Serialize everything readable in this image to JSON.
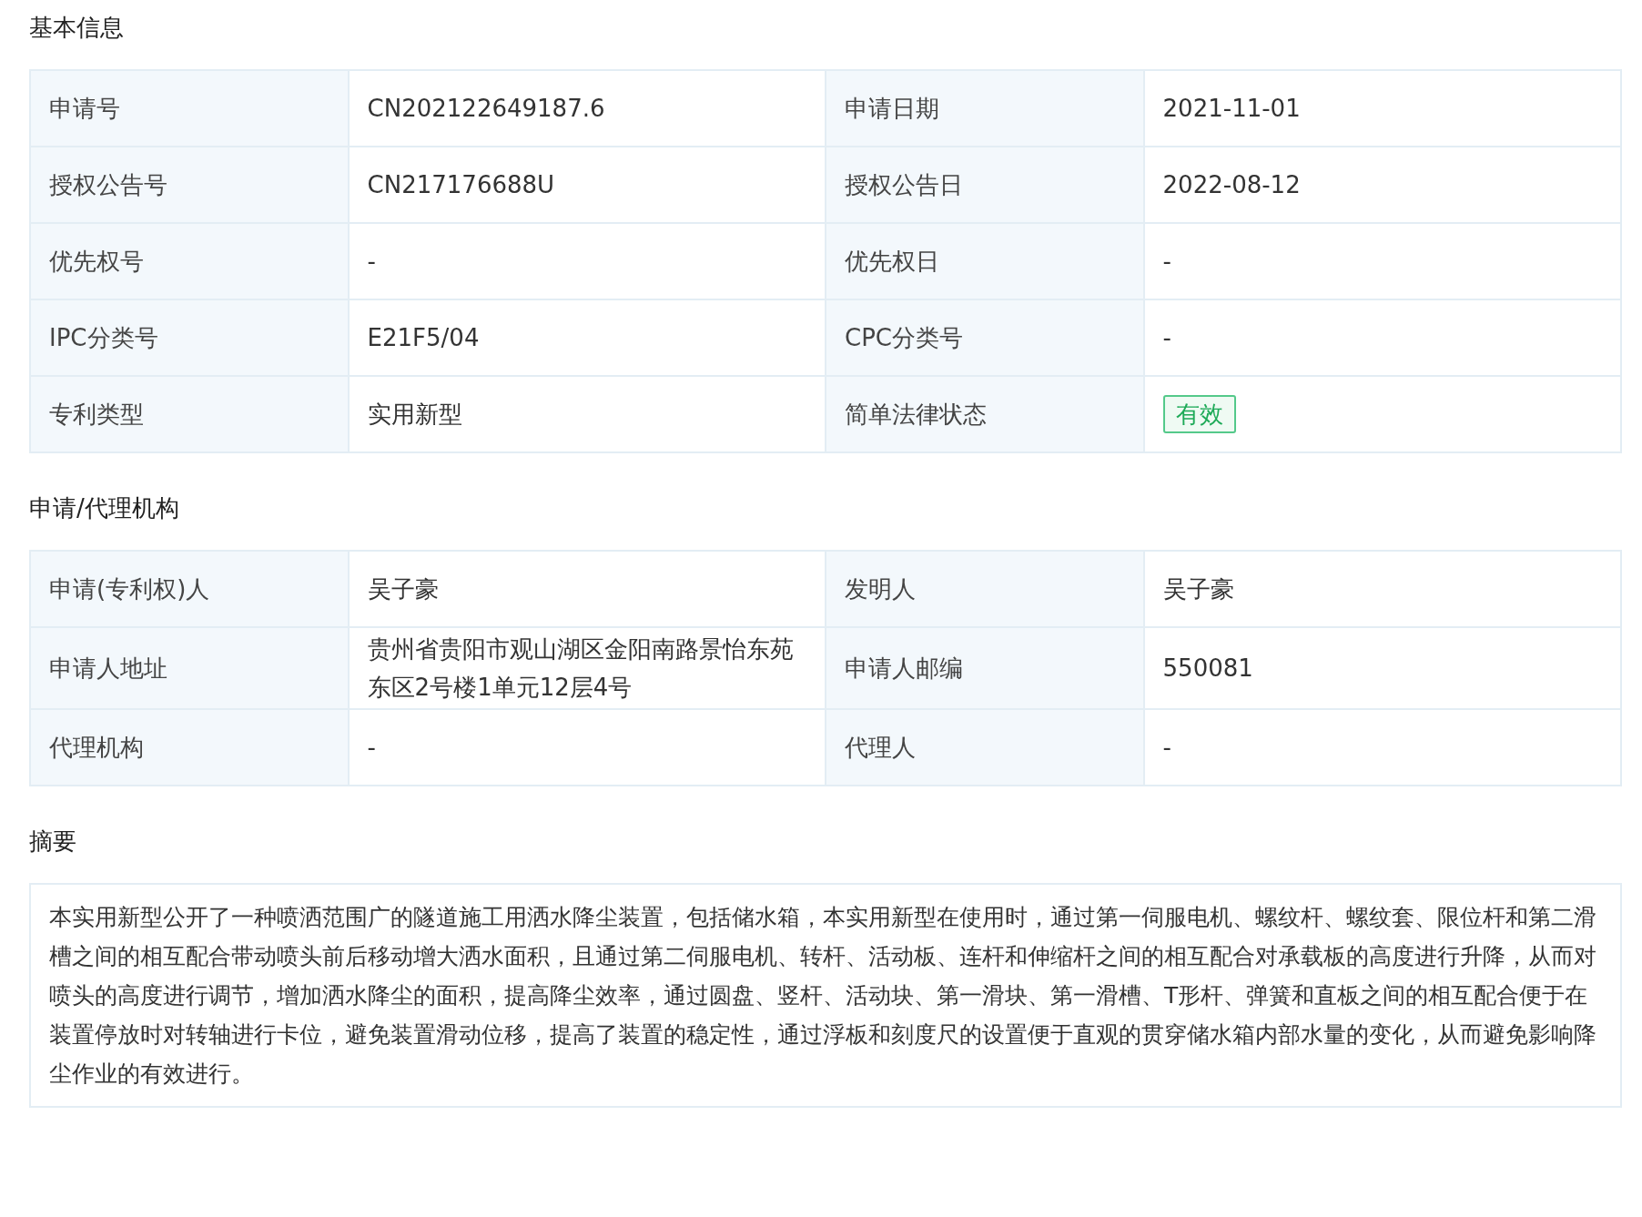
{
  "sections": [
    {
      "kind": "grid",
      "title": "基本信息",
      "rows": [
        [
          {
            "label": "申请号",
            "value": "CN202122649187.6"
          },
          {
            "label": "申请日期",
            "value": "2021-11-01"
          }
        ],
        [
          {
            "label": "授权公告号",
            "value": "CN217176688U"
          },
          {
            "label": "授权公告日",
            "value": "2022-08-12"
          }
        ],
        [
          {
            "label": "优先权号",
            "value": "-"
          },
          {
            "label": "优先权日",
            "value": "-"
          }
        ],
        [
          {
            "label": "IPC分类号",
            "value": "E21F5/04"
          },
          {
            "label": "CPC分类号",
            "value": "-"
          }
        ],
        [
          {
            "label": "专利类型",
            "value": "实用新型"
          },
          {
            "label": "简单法律状态",
            "value": "有效",
            "kind": "tag"
          }
        ]
      ]
    },
    {
      "kind": "grid",
      "title": "申请/代理机构",
      "rows": [
        [
          {
            "label": "申请(专利权)人",
            "value": "吴子豪"
          },
          {
            "label": "发明人",
            "value": "吴子豪"
          }
        ],
        [
          {
            "label": "申请人地址",
            "value": "贵州省贵阳市观山湖区金阳南路景怡东苑东区2号楼1单元12层4号"
          },
          {
            "label": "申请人邮编",
            "value": "550081"
          }
        ],
        [
          {
            "label": "代理机构",
            "value": "-"
          },
          {
            "label": "代理人",
            "value": "-"
          }
        ]
      ]
    },
    {
      "kind": "text",
      "title": "摘要",
      "text": "本实用新型公开了一种喷洒范围广的隧道施工用洒水降尘装置，包括储水箱，本实用新型在使用时，通过第一伺服电机、螺纹杆、螺纹套、限位杆和第二滑槽之间的相互配合带动喷头前后移动增大洒水面积，且通过第二伺服电机、转杆、活动板、连杆和伸缩杆之间的相互配合对承载板的高度进行升降，从而对喷头的高度进行调节，增加洒水降尘的面积，提高降尘效率，通过圆盘、竖杆、活动块、第一滑块、第一滑槽、T形杆、弹簧和直板之间的相互配合便于在装置停放时对转轴进行卡位，避免装置滑动位移，提高了装置的稳定性，通过浮板和刻度尺的设置便于直观的贯穿储水箱内部水量的变化，从而避免影响降尘作业的有效进行。"
    }
  ]
}
